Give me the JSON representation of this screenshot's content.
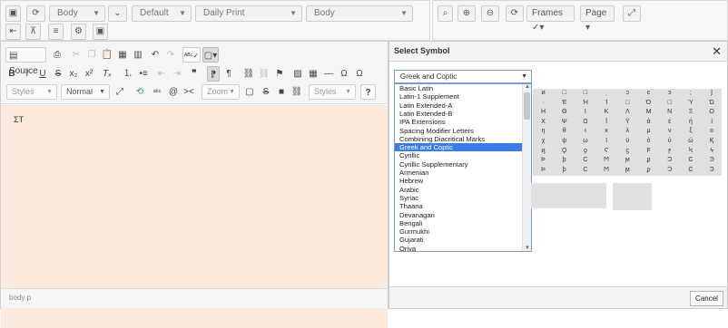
{
  "top_toolbar": {
    "left_selects": [
      "Body",
      "Default",
      "Daily Print",
      "Body"
    ],
    "right_buttons": {
      "frames_label": "Frames",
      "page_label": "Page"
    }
  },
  "editor": {
    "toolbar": {
      "source_label": "Source",
      "styles_combo": "Styles",
      "format_combo": "Normal",
      "zoom_combo": "Zoom",
      "styles_combo2": "Styles"
    },
    "content_text": "ΣΤ",
    "path": "body  p"
  },
  "dialog": {
    "title": "Select Symbol",
    "close_glyph": "✕",
    "selected_block": "Greek and Coptic",
    "blocks": [
      "Basic Latin",
      "Latin-1 Supplement",
      "Latin Extended-A",
      "Latin Extended-B",
      "IPA Extensions",
      "Spacing Modifier Letters",
      "Combining Diacritical Marks",
      "Greek and Coptic",
      "Cyrillic",
      "Cyrillic Supplementary",
      "Armenian",
      "Hebrew",
      "Arabic",
      "Syriac",
      "Thaana",
      "Devanagari",
      "Bengali",
      "Gurmukhi",
      "Gujarati",
      "Oriya"
    ],
    "symbols": [
      [
        "ͷ",
        "□",
        "□",
        "ͺ",
        "ͻ",
        "ͼ",
        "ͽ",
        ";",
        "Ϳ"
      ],
      [
        "·",
        "Έ",
        "Ή",
        "Ί",
        "□",
        "Ό",
        "□",
        "Ύ",
        "Ώ"
      ],
      [
        "Η",
        "Θ",
        "Ι",
        "Κ",
        "Λ",
        "Μ",
        "Ν",
        "Ξ",
        "Ο"
      ],
      [
        "Χ",
        "Ψ",
        "Ω",
        "Ϊ",
        "Ϋ",
        "ά",
        "έ",
        "ή",
        "ί"
      ],
      [
        "η",
        "θ",
        "ι",
        "κ",
        "λ",
        "μ",
        "ν",
        "ξ",
        "ο"
      ],
      [
        "χ",
        "ψ",
        "ω",
        "ϊ",
        "ϋ",
        "ό",
        "ύ",
        "ώ",
        "Ϗ"
      ],
      [
        "ϗ",
        "Ϙ",
        "ϙ",
        "Ϛ",
        "ϛ",
        "Ϝ",
        "ϝ",
        "Ϟ",
        "ϟ"
      ],
      [
        "Ϸ",
        "ϸ",
        "Ϲ",
        "Ϻ",
        "ϻ",
        "ϼ",
        "Ͻ",
        "Ͼ",
        "Ͽ"
      ],
      [
        "Ϸ",
        "ϸ",
        "Ϲ",
        "Ϻ",
        "ϻ",
        "ϼ",
        "Ͻ",
        "Ͼ",
        "Ͽ"
      ]
    ],
    "cancel_label": "Cancel"
  }
}
